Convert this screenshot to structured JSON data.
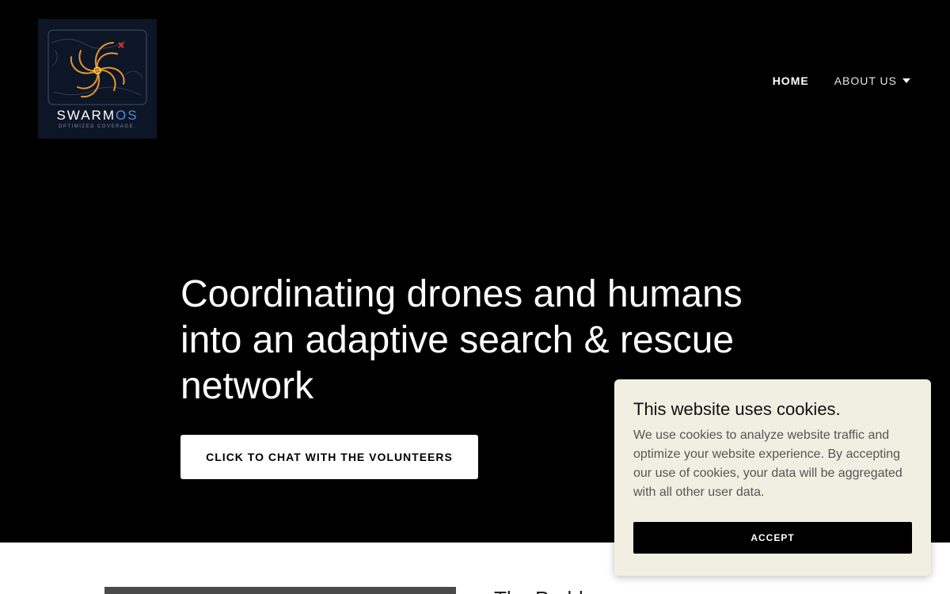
{
  "logo": {
    "word_main": "SWARM",
    "word_accent": "OS",
    "tagline": "OPTIMIZED COVERAGE."
  },
  "nav": [
    {
      "label": "HOME",
      "active": true
    },
    {
      "label": "ABOUT US",
      "active": false,
      "icon": "caret-down-icon"
    }
  ],
  "hero": {
    "headline": "Coordinating drones and humans into an adaptive search & rescue network",
    "cta_label": "CLICK TO CHAT WITH THE VOLUNTEERS"
  },
  "section": {
    "heading": "The Problem"
  },
  "cookie_banner": {
    "title": "This website uses cookies.",
    "body": "We use cookies to analyze website traffic and optimize your website experience. By accepting our use of cookies, your data will be aggregated with all other user data.",
    "accept_label": "ACCEPT"
  },
  "colors": {
    "hero_bg": "#000000",
    "logo_bg": "#0d1626",
    "logo_accent": "#e8962d",
    "logo_os": "#4f8ee0",
    "cookie_bg": "#f1efe2"
  }
}
